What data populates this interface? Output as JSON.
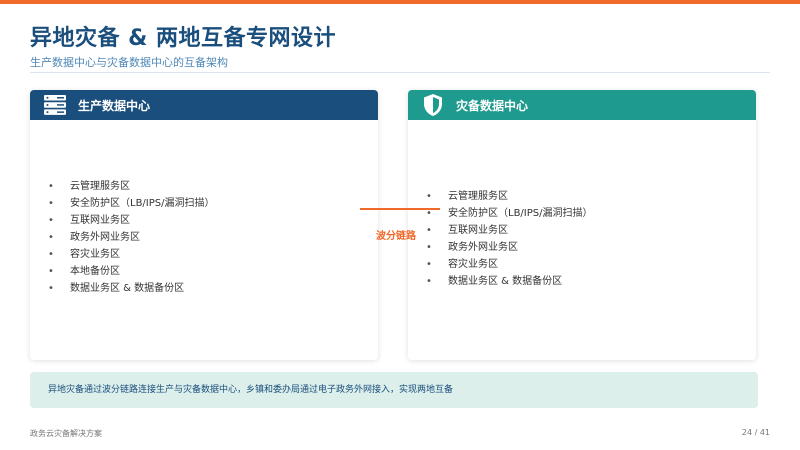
{
  "title": "异地灾备 & 两地互备专网设计",
  "subtitle": "生产数据中心与灾备数据中心的互备架构",
  "colors": {
    "accent": "#f06a2b",
    "primary": "#1a4e7c",
    "teal": "#1f9a8e",
    "note_bg": "#dcefeb"
  },
  "left_card": {
    "icon": "server-icon",
    "title": "生产数据中心",
    "items": [
      "云管理服务区",
      "安全防护区（LB/IPS/漏洞扫描）",
      "互联网业务区",
      "政务外网业务区",
      "容灾业务区",
      "本地备份区",
      "数据业务区 & 数据备份区"
    ]
  },
  "right_card": {
    "icon": "shield-icon",
    "title": "灾备数据中心",
    "items": [
      "云管理服务区",
      "安全防护区（LB/IPS/漏洞扫描）",
      "互联网业务区",
      "政务外网业务区",
      "容灾业务区",
      "数据业务区 & 数据备份区"
    ]
  },
  "link_label": "波分链路",
  "note": "异地灾备通过波分链路连接生产与灾备数据中心，乡镇和委办局通过电子政务外网接入，实现两地互备",
  "footer": {
    "doc_name": "政务云灾备解决方案",
    "page": "24 / 41"
  },
  "bullet": "•"
}
